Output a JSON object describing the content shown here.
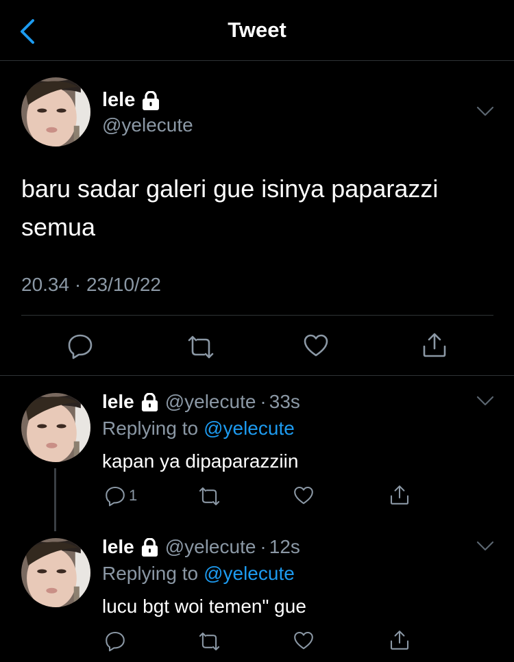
{
  "header": {
    "title": "Tweet"
  },
  "tweet": {
    "name": "lele",
    "handle": "@yelecute",
    "text": "baru sadar galeri gue isinya paparazzi semua",
    "time": "20.34",
    "separator": "·",
    "date": "23/10/22"
  },
  "replies": [
    {
      "name": "lele",
      "handle": "@yelecute",
      "separator": "·",
      "age": "33s",
      "replying_label": "Replying to",
      "replying_to": "@yelecute",
      "text": "kapan ya dipaparazziin",
      "reply_count": "1"
    },
    {
      "name": "lele",
      "handle": "@yelecute",
      "separator": "·",
      "age": "12s",
      "replying_label": "Replying to",
      "replying_to": "@yelecute",
      "text": "lucu bgt woi temen\" gue",
      "reply_count": ""
    }
  ],
  "icons": [
    "back-chevron-icon",
    "lock-icon",
    "chevron-down-icon",
    "reply-icon",
    "retweet-icon",
    "like-icon",
    "share-icon"
  ],
  "colors": {
    "background": "#000000",
    "accent": "#1d9bf0",
    "muted": "#8b98a5",
    "divider": "#2f3336"
  }
}
